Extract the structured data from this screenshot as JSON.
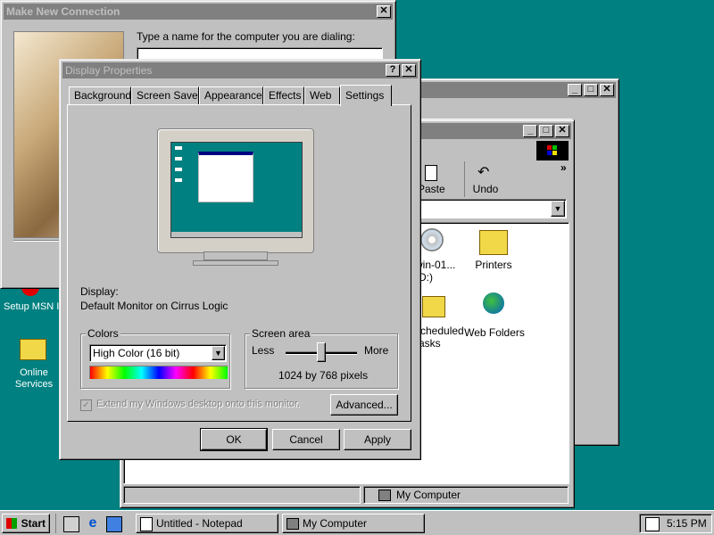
{
  "desktop": {
    "icons": [
      {
        "label": "Setup MSN Internet A..."
      },
      {
        "label": "Online Services"
      }
    ]
  },
  "connection_window": {
    "title": "Make New Connection",
    "prompt": "Type a name for the computer you are dialing:"
  },
  "mycomputer_window": {
    "toolbar": {
      "paste_label": "Paste",
      "undo_label": "Undo",
      "more": "»"
    },
    "icons": [
      {
        "label": "win-01...\n(D:)"
      },
      {
        "label": "Printers"
      },
      {
        "label": "Scheduled\nTasks"
      },
      {
        "label": "Web Folders"
      }
    ],
    "status_text": "My Computer"
  },
  "display_properties": {
    "title": "Display Properties",
    "tabs": [
      "Background",
      "Screen Saver",
      "Appearance",
      "Effects",
      "Web",
      "Settings"
    ],
    "active_tab": "Settings",
    "display_label": "Display:",
    "display_value": "Default Monitor on Cirrus Logic",
    "colors_group": "Colors",
    "colors_value": "High Color (16 bit)",
    "screen_area_group": "Screen area",
    "less_label": "Less",
    "more_label": "More",
    "resolution_text": "1024 by 768 pixels",
    "extend_label": "Extend my Windows desktop onto this monitor.",
    "extend_checked": true,
    "advanced_label": "Advanced...",
    "ok_label": "OK",
    "cancel_label": "Cancel",
    "apply_label": "Apply",
    "slider_position": 0.5
  },
  "taskbar": {
    "start_label": "Start",
    "tasks": [
      {
        "label": "Untitled - Notepad"
      },
      {
        "label": "My Computer"
      }
    ],
    "clock": "5:15 PM"
  },
  "colors": {
    "desktop": "#008080",
    "inactive_title": "#808080",
    "face": "#c0c0c0"
  }
}
